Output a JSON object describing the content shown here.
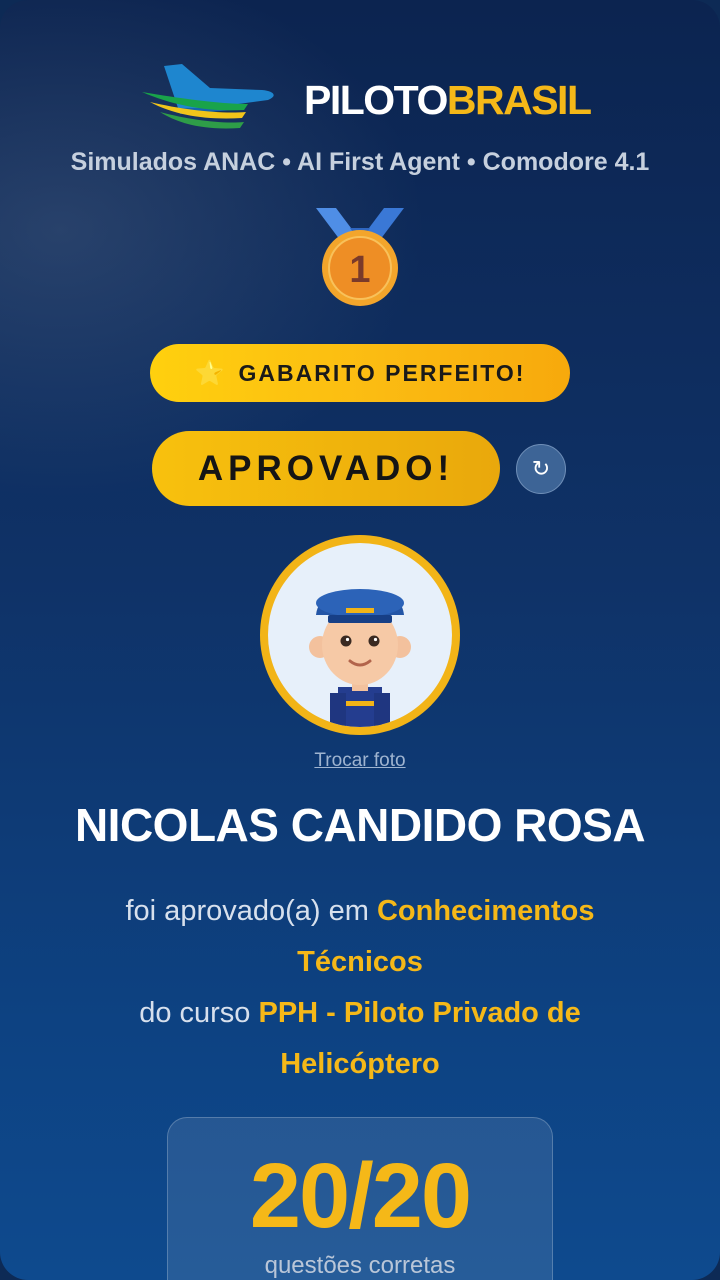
{
  "brand": {
    "part1": "PILOTO",
    "part2": "BRASIL"
  },
  "tagline": "Simulados ANAC • AI First Agent • Comodore 4.1",
  "medal": {
    "icon": "medal-icon",
    "rank": "1"
  },
  "badge_perfect": {
    "icon": "star-icon",
    "star": "⭐",
    "label": "GABARITO PERFEITO!"
  },
  "approved_button": {
    "label": "APROVADO!"
  },
  "refresh_button": {
    "icon": "refresh-icon",
    "glyph": "↻"
  },
  "avatar": {
    "icon": "pilot-avatar-icon"
  },
  "change_photo": "Trocar foto",
  "student_name": "NICOLAS CANDIDO ROSA",
  "description": {
    "prefix": "foi aprovado(a) em ",
    "subject": "Conhecimentos Técnicos",
    "course_prefix": "do curso ",
    "course": "PPH - Piloto Privado de Helicóptero"
  },
  "score": {
    "value": "20/20",
    "label": "questões corretas"
  },
  "colors": {
    "accent_gold": "#f5b818",
    "background_navy": "#0c2450",
    "background_blue": "#0e4a8e",
    "text_white": "#ffffff"
  }
}
